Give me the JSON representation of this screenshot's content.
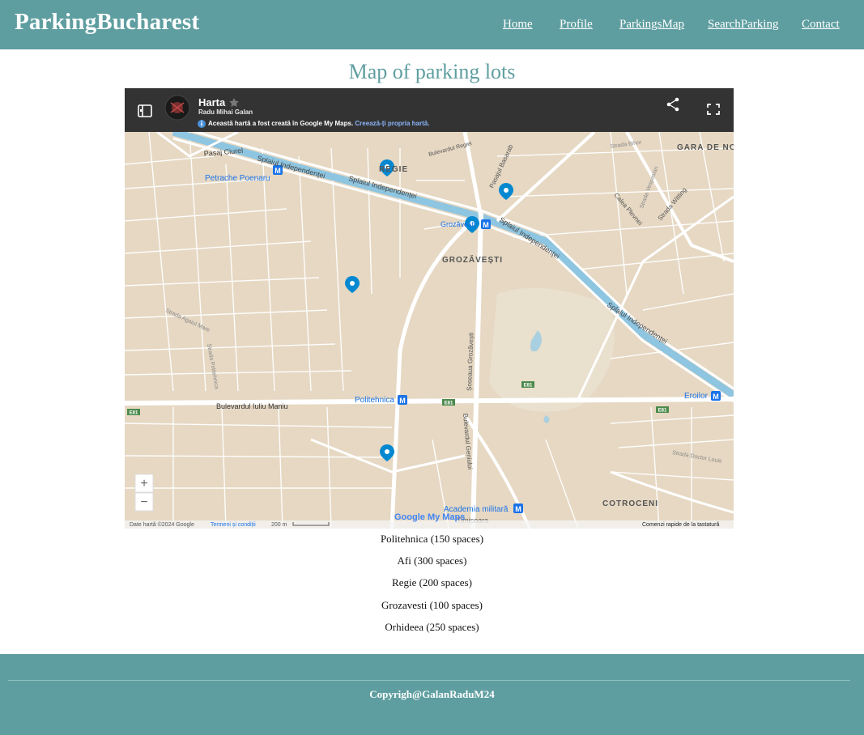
{
  "site": {
    "brand": "ParkingBucharest"
  },
  "nav": {
    "home": "Home",
    "profile": "Profile",
    "parkings_map": "ParkingsMap",
    "search_parking": "SearchParking",
    "contact": "Contact"
  },
  "page": {
    "title": "Map of parking lots"
  },
  "map": {
    "title": "Harta",
    "author": "Radu Mihai Galan",
    "notice": "Această hartă a fost creată în Google My Maps.",
    "notice_link": "Creează-ți propria hartă.",
    "labels": {
      "regie": "REGIE",
      "pasaj_ciurel": "Pasaj Ciurel",
      "splaiul_1": "Splaiul Independenței",
      "splaiul_2": "Splaiul Independenței",
      "splaiul_3": "Splaiul Independenței",
      "splaiul_4": "Splaiul Independenței",
      "petrache": "Petrache Poenaru",
      "bd_regiei": "Bulevardul Regiei",
      "pasajul_basarab": "Pasajul Basarab",
      "strada_bihor": "Strada Bihor",
      "strada_vespasian": "Strada Vespasian",
      "strada_witting": "Strada Witting",
      "calea_plevnei": "Calea Plevnei",
      "gara_de_nord": "GARA DE NO",
      "grozavesti_station": "Grozăvești",
      "grozavesti_area": "GROZĂVEȘTI",
      "strada_mare": "Strada Agaiul Mare",
      "strada_politehnica": "Strada Politehnica",
      "soseaua_grozavesti": "Șoseaua Grozăvești",
      "bd_iuliu_maniu": "Bulevardul Iuliu Maniu",
      "politehnica_station": "Politehnica",
      "bd_geniului": "Bulevardul Geniului",
      "eroilor": "Eroilor",
      "strada_doctor_louis": "Strada Doctor Louis",
      "cotroceni": "COTROCENI",
      "academia": "Academia militară",
      "timisoara": "Timișoara",
      "e81": "E81"
    },
    "zoom_in": "+",
    "zoom_out": "−",
    "footer_data": "Date hartă ©2024 Google",
    "footer_terms": "Termeni și condiții",
    "footer_scale": "200 m",
    "footer_shortcuts": "Comenzi rapide de la tastatură",
    "google_logo": "Google My Maps"
  },
  "lots": [
    {
      "label": "Politehnica (150 spaces)"
    },
    {
      "label": "Afi (300 spaces)"
    },
    {
      "label": "Regie (200 spaces)"
    },
    {
      "label": "Grozavesti (100 spaces)"
    },
    {
      "label": "Orhideea (250 spaces)"
    }
  ],
  "footer": {
    "copyright": "Copyrigh@GalanRaduM24"
  },
  "colors": {
    "accent": "#5f9ea0",
    "map_land": "#e6d8c3",
    "river": "#8ec5e0",
    "pin": "#0288d1",
    "map_bar": "#333333"
  }
}
